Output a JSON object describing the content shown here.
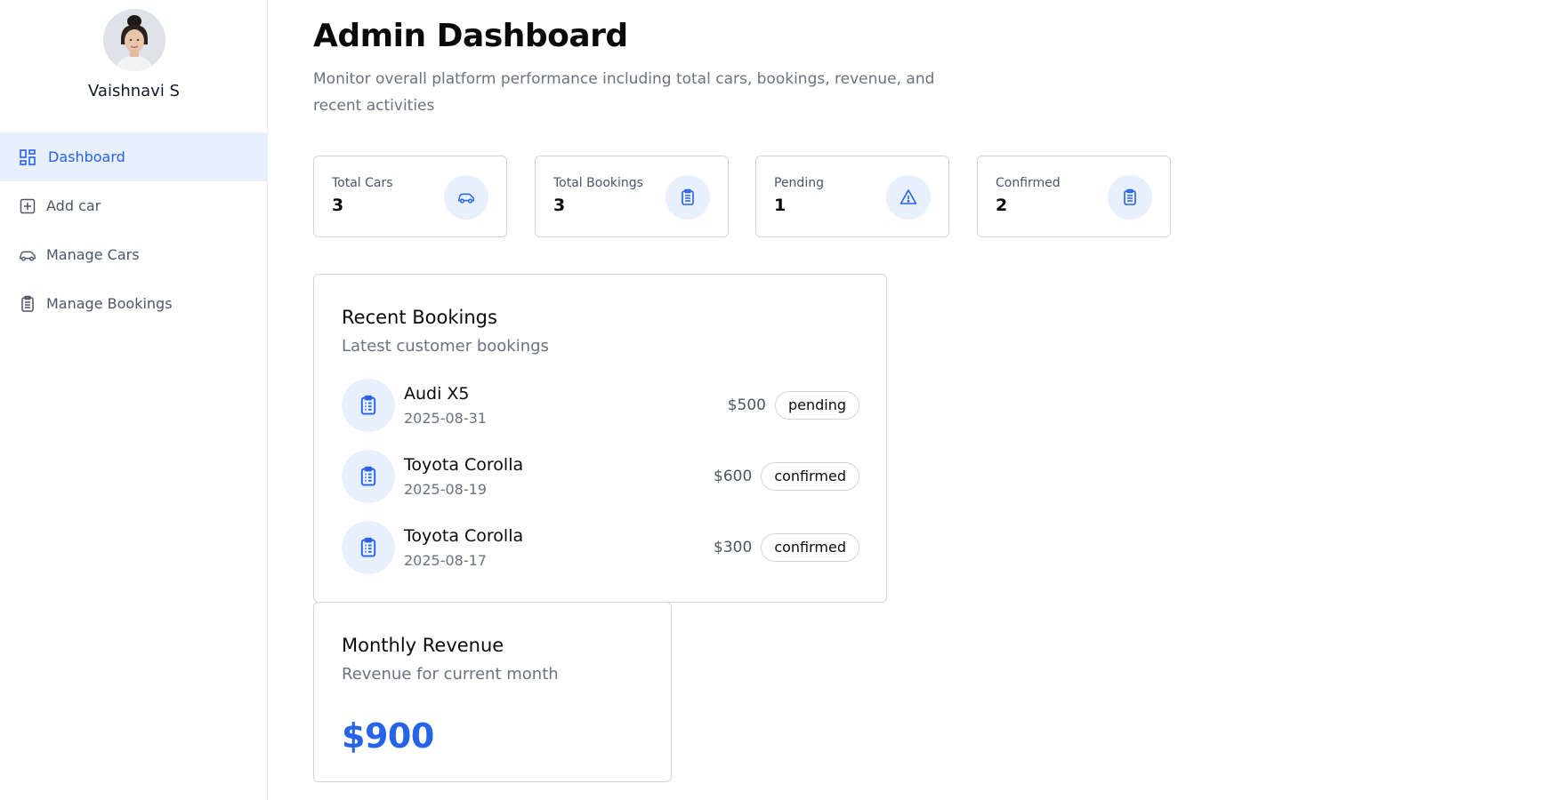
{
  "sidebar": {
    "user_name": "Vaishnavi S",
    "items": [
      {
        "label": "Dashboard",
        "icon": "dashboard-icon",
        "active": true
      },
      {
        "label": "Add car",
        "icon": "add-square-icon",
        "active": false
      },
      {
        "label": "Manage Cars",
        "icon": "car-icon",
        "active": false
      },
      {
        "label": "Manage Bookings",
        "icon": "clipboard-icon",
        "active": false
      }
    ]
  },
  "header": {
    "title": "Admin Dashboard",
    "subtitle": "Monitor overall platform performance including total cars, bookings, revenue, and recent activities"
  },
  "stats": [
    {
      "label": "Total Cars",
      "value": "3",
      "icon": "car-icon"
    },
    {
      "label": "Total Bookings",
      "value": "3",
      "icon": "clipboard-icon"
    },
    {
      "label": "Pending",
      "value": "1",
      "icon": "warning-icon"
    },
    {
      "label": "Confirmed",
      "value": "2",
      "icon": "clipboard-icon"
    }
  ],
  "recent_bookings": {
    "title": "Recent Bookings",
    "subtitle": "Latest customer bookings",
    "rows": [
      {
        "car": "Audi X5",
        "date": "2025-08-31",
        "price": "$500",
        "status": "pending"
      },
      {
        "car": "Toyota Corolla",
        "date": "2025-08-19",
        "price": "$600",
        "status": "confirmed"
      },
      {
        "car": "Toyota Corolla",
        "date": "2025-08-17",
        "price": "$300",
        "status": "confirmed"
      }
    ]
  },
  "monthly_revenue": {
    "title": "Monthly Revenue",
    "subtitle": "Revenue for current month",
    "value": "$900"
  },
  "colors": {
    "accent": "#2563eb",
    "accent_soft": "#e8effd",
    "border": "#d1d5db",
    "muted_text": "#6b7280"
  }
}
